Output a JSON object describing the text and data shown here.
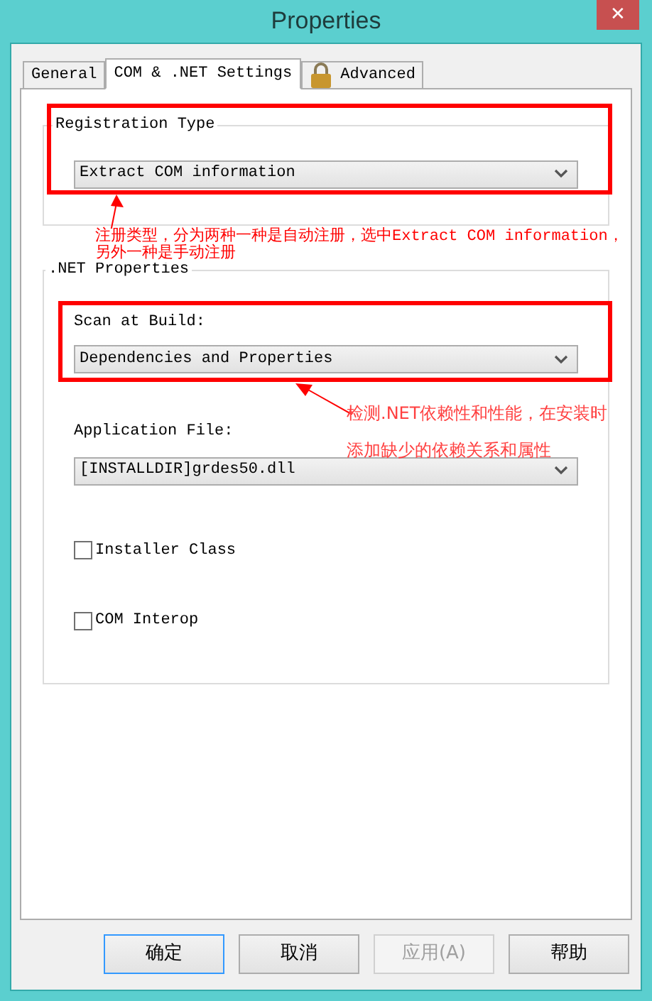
{
  "window": {
    "title": "Properties",
    "close": "✕"
  },
  "tabs": [
    {
      "label": "General",
      "selected": false,
      "locked": false
    },
    {
      "label": "COM & .NET Settings",
      "selected": true,
      "locked": false
    },
    {
      "label": "Advanced",
      "selected": false,
      "locked": true
    }
  ],
  "registration_group": {
    "title": "Registration Type",
    "dropdown": {
      "value": "Extract COM information"
    }
  },
  "net_group": {
    "title": ".NET Properties",
    "scan_label": "Scan at Build:",
    "scan_dropdown": {
      "value": "Dependencies and Properties"
    },
    "file_label": "Application File:",
    "file_dropdown": {
      "value": "[INSTALLDIR]grdes50.dll"
    },
    "checkboxes": [
      {
        "label": "Installer Class",
        "checked": false
      },
      {
        "label": "COM Interop",
        "checked": false
      }
    ]
  },
  "annotations": [
    {
      "lines": [
        "注册类型，分为两种一种是自动注册，选中Extract COM information，",
        "另外一种是手动注册"
      ]
    },
    {
      "lines": [
        "检测.NET依赖性和性能，在安装时",
        "添加缺少的依赖关系和属性"
      ]
    }
  ],
  "buttons": [
    {
      "label": "确定",
      "disabled": false,
      "focused": true
    },
    {
      "label": "取消",
      "disabled": false,
      "focused": false
    },
    {
      "label": "应用(A)",
      "disabled": true,
      "focused": false
    },
    {
      "label": "帮助",
      "disabled": false,
      "focused": false
    }
  ]
}
